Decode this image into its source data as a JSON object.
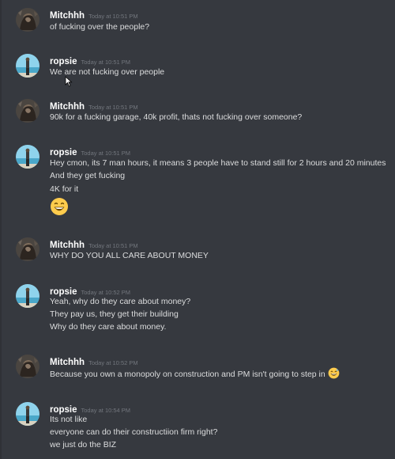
{
  "messages": [
    {
      "user": "Mitchhh",
      "time": "Today at 10:51 PM",
      "lines": [
        "of fucking over the people?"
      ]
    },
    {
      "user": "ropsie",
      "time": "Today at 10:51 PM",
      "lines": [
        "We are not fucking over people"
      ]
    },
    {
      "user": "Mitchhh",
      "time": "Today at 10:51 PM",
      "lines": [
        "90k for a fucking garage, 40k profit, thats not fucking over someone?"
      ]
    },
    {
      "user": "ropsie",
      "time": "Today at 10:51 PM",
      "lines": [
        "Hey cmon, its 7 man hours, it means 3 people have to stand still for 2 hours and 20 minutes",
        "And they get fucking",
        "4K for it"
      ],
      "emoji": "grinning-face-emoji"
    },
    {
      "user": "Mitchhh",
      "time": "Today at 10:51 PM",
      "lines": [
        "WHY DO YOU ALL CARE ABOUT MONEY"
      ]
    },
    {
      "user": "ropsie",
      "time": "Today at 10:52 PM",
      "lines": [
        "Yeah, why do they care about money?",
        "They pay us, they get their building",
        "Why do they care about money."
      ]
    },
    {
      "user": "Mitchhh",
      "time": "Today at 10:52 PM",
      "lines": [
        "Because you own a monopoly on construction and PM isn't going to step in"
      ],
      "inline_emoji": "sweat-smile-emoji"
    },
    {
      "user": "ropsie",
      "time": "Today at 10:54 PM",
      "lines": [
        "Its not like",
        "everyone can do their constructiion firm right?",
        "we just do the BIZ"
      ]
    }
  ],
  "colors": {
    "background": "#36393f",
    "username": "#ffffff",
    "timestamp": "#72767d",
    "message_text": "#dcddde"
  }
}
